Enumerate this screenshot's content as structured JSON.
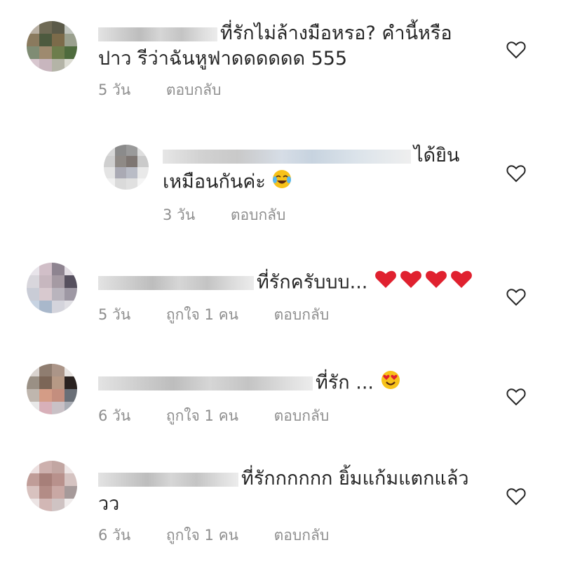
{
  "comments": [
    {
      "text": "ที่รักไม่ล้างมือหรอ? คำนี้หรือปาว รีว่าฉันหูฟาดดดดดด 555",
      "time": "5 วัน",
      "likes": "",
      "reply": "ตอบกลับ",
      "like_icon": "heart-outline-icon"
    },
    {
      "text": "ได้ยินเหมือนกันค่ะ",
      "emoji": "tears-of-joy-emoji",
      "time": "3 วัน",
      "likes": "",
      "reply": "ตอบกลับ",
      "like_icon": "heart-outline-icon"
    },
    {
      "text": "ที่รักครับบบ...",
      "emoji": "red-hearts-emoji",
      "time": "5 วัน",
      "likes": "ถูกใจ 1 คน",
      "reply": "ตอบกลับ",
      "like_icon": "heart-outline-icon"
    },
    {
      "text": "ที่รัก ...",
      "emoji": "heart-eyes-emoji",
      "time": "6 วัน",
      "likes": "ถูกใจ 1 คน",
      "reply": "ตอบกลับ",
      "like_icon": "heart-outline-icon"
    },
    {
      "text": "ที่รักกกกกก ยิ้มแก้มแตกแล้ววว",
      "time": "6 วัน",
      "likes": "ถูกใจ 1 คน",
      "reply": "ตอบกลับ",
      "like_icon": "heart-outline-icon"
    }
  ],
  "colors": {
    "text": "#262626",
    "meta": "#8e8e8e",
    "heart_red": "#e0212f",
    "emoji_yellow": "#f7c21a"
  }
}
